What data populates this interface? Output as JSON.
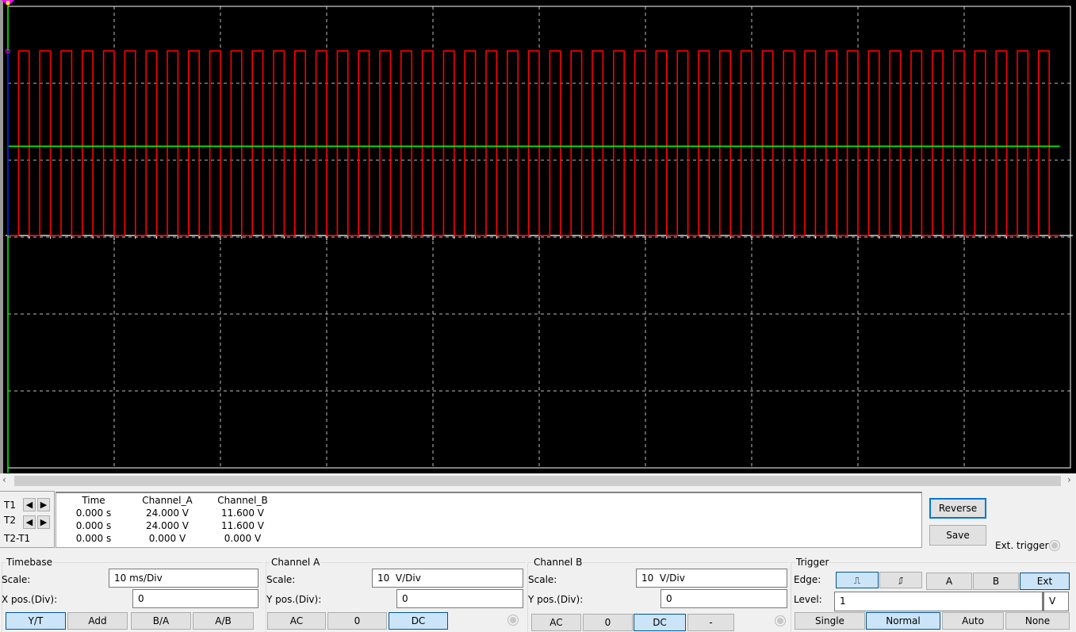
{
  "screen": {
    "background": "#000000",
    "grid_color": "#bbbbbb",
    "channel_a_color": "#ff0000",
    "channel_b_color": "#00ff00",
    "cursor_color": "#0000ff"
  },
  "chart_data": {
    "type": "line",
    "x_unit": "ms",
    "y_unit": "V",
    "xlim": [
      0,
      100
    ],
    "ylim": [
      -30,
      30
    ],
    "x_divisions": 10,
    "y_divisions": 6,
    "grid": true,
    "series": [
      {
        "name": "Channel_A",
        "color": "#ff0000",
        "waveform": "square",
        "period_ms": 2,
        "duty": 0.5,
        "high": 24,
        "low": 0,
        "first_rise_ms": 1,
        "end_ms": 99
      },
      {
        "name": "Channel_B",
        "color": "#00ff00",
        "waveform": "dc",
        "value": 11.6,
        "end_ms": 99
      }
    ]
  },
  "cursors": {
    "t1_label": "T1",
    "t2_label": "T2",
    "diff_label": "T2-T1",
    "left_arrow": "🡄",
    "right_arrow": "🡆"
  },
  "readout": {
    "headers": [
      "Time",
      "Channel_A",
      "Channel_B"
    ],
    "rows": [
      [
        "0.000 s",
        "24.000 V",
        "11.600 V"
      ],
      [
        "0.000 s",
        "24.000 V",
        "11.600 V"
      ],
      [
        "0.000 s",
        "0.000 V",
        "0.000 V"
      ]
    ]
  },
  "actions": {
    "reverse": "Reverse",
    "save": "Save",
    "ext_trigger": "Ext. trigger"
  },
  "timebase": {
    "title": "Timebase",
    "scale_label": "Scale:",
    "scale": "10 ms/Div",
    "xpos_label": "X pos.(Div):",
    "xpos": "0",
    "modes": [
      "Y/T",
      "Add",
      "B/A",
      "A/B"
    ],
    "active_mode": "Y/T"
  },
  "channel_a": {
    "title": "Channel A",
    "scale_label": "Scale:",
    "scale": "10  V/Div",
    "ypos_label": "Y pos.(Div):",
    "ypos": "0",
    "coupling": [
      "AC",
      "0",
      "DC"
    ],
    "active": "DC"
  },
  "channel_b": {
    "title": "Channel B",
    "scale_label": "Scale:",
    "scale": "10  V/Div",
    "ypos_label": "Y pos.(Div):",
    "ypos": "0",
    "coupling": [
      "AC",
      "0",
      "DC",
      "-"
    ],
    "active": "DC"
  },
  "trigger": {
    "title": "Trigger",
    "edge_label": "Edge:",
    "rising": "rising-edge-icon",
    "falling": "falling-edge-icon",
    "sources": [
      "A",
      "B",
      "Ext"
    ],
    "active_source": "Ext",
    "level_label": "Level:",
    "level": "1",
    "level_unit": "V",
    "modes": [
      "Single",
      "Normal",
      "Auto",
      "None"
    ],
    "active_mode": "Normal"
  }
}
